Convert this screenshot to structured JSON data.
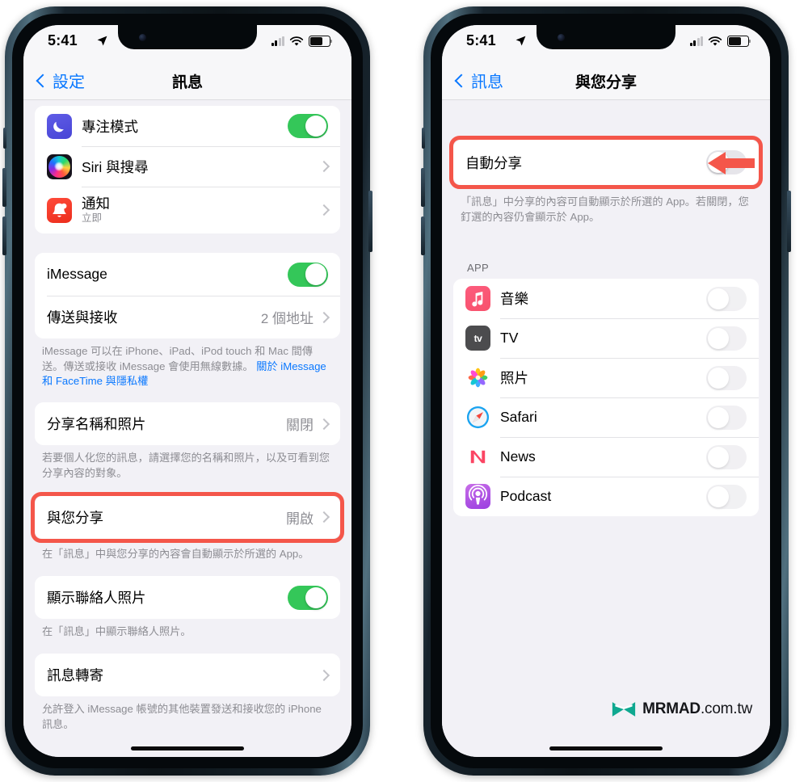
{
  "meta": {
    "accent_blue": "#0a78ff",
    "toggle_green": "#34c759",
    "highlight_red": "#f4564a",
    "screen_bg": "#f2f1f6"
  },
  "status_bar": {
    "time": "5:41",
    "location_icon": "location-arrow-icon",
    "signal_icon": "cellular-signal-icon",
    "wifi_icon": "wifi-icon",
    "battery_icon": "battery-icon"
  },
  "left_phone": {
    "nav": {
      "back_label": "設定",
      "title": "訊息"
    },
    "section_focus": [
      {
        "icon": "focus-mode-icon",
        "label": "專注模式",
        "control": "toggle-on"
      },
      {
        "icon": "siri-icon",
        "label": "Siri 與搜尋",
        "control": "chevron"
      },
      {
        "icon": "notifications-icon",
        "label": "通知",
        "sublabel": "立即",
        "control": "chevron"
      }
    ],
    "section_imessage": [
      {
        "label": "iMessage",
        "control": "toggle-on"
      },
      {
        "label": "傳送與接收",
        "value": "2 個地址",
        "control": "chevron"
      }
    ],
    "footnote_imessage": "iMessage 可以在 iPhone、iPad、iPod touch 和 Mac 間傳送。傳送或接收 iMessage 會使用無線數據。",
    "footnote_imessage_link": "關於 iMessage 和 FaceTime 與隱私權",
    "section_share_name": [
      {
        "label": "分享名稱和照片",
        "value": "關閉",
        "control": "chevron"
      }
    ],
    "footnote_share_name": "若要個人化您的訊息，請選擇您的名稱和照片，以及可看到您分享內容的對象。",
    "section_shared_with_you": [
      {
        "label": "與您分享",
        "value": "開啟",
        "control": "chevron",
        "highlighted": true
      }
    ],
    "footnote_shared_with_you": "在「訊息」中與您分享的內容會自動顯示於所選的 App。",
    "section_contact_photo": [
      {
        "label": "顯示聯絡人照片",
        "control": "toggle-on"
      }
    ],
    "footnote_contact_photo": "在「訊息」中顯示聯絡人照片。",
    "section_forwarding": [
      {
        "label": "訊息轉寄",
        "control": "chevron"
      }
    ],
    "footnote_forwarding": "允許登入 iMessage 帳號的其他裝置發送和接收您的 iPhone 訊息。"
  },
  "right_phone": {
    "nav": {
      "back_label": "訊息",
      "title": "與您分享"
    },
    "section_auto": [
      {
        "label": "自動分享",
        "control": "toggle-off",
        "highlighted": true,
        "annotation": "red-arrow-icon"
      }
    ],
    "footnote_auto": "「訊息」中分享的內容可自動顯示於所選的 App。若關閉，您釘選的內容仍會顯示於 App。",
    "apps_header": "APP",
    "apps": [
      {
        "icon": "music-app-icon",
        "label": "音樂",
        "control": "toggle-off-dim"
      },
      {
        "icon": "tv-app-icon",
        "label": "TV",
        "control": "toggle-off-dim"
      },
      {
        "icon": "photos-app-icon",
        "label": "照片",
        "control": "toggle-off-dim"
      },
      {
        "icon": "safari-app-icon",
        "label": "Safari",
        "control": "toggle-off-dim"
      },
      {
        "icon": "news-app-icon",
        "label": "News",
        "control": "toggle-off-dim"
      },
      {
        "icon": "podcasts-app-icon",
        "label": "Podcast",
        "control": "toggle-off-dim"
      }
    ],
    "watermark": {
      "logo": "mrmad-logo-icon",
      "name": "MRMAD",
      "domain": ".com.tw"
    }
  }
}
